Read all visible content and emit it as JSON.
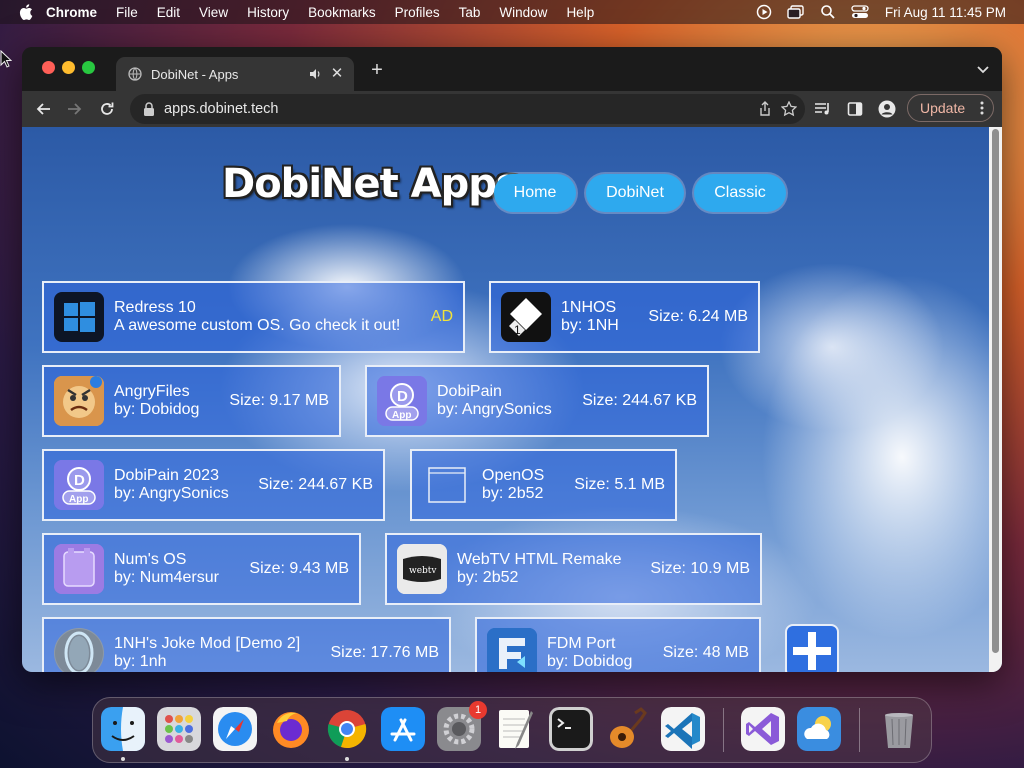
{
  "menubar": {
    "app": "Chrome",
    "items": [
      "File",
      "Edit",
      "View",
      "History",
      "Bookmarks",
      "Profiles",
      "Tab",
      "Window",
      "Help"
    ],
    "clock": "Fri Aug 11  11:45 PM"
  },
  "browser": {
    "tab_title": "DobiNet - Apps",
    "url": "apps.dobinet.tech",
    "update_label": "Update"
  },
  "page": {
    "logo": "DobiNet Apps",
    "nav": [
      "Home",
      "DobiNet",
      "Classic"
    ]
  },
  "apps": [
    {
      "name": "Redress 10",
      "subtitle": "A awesome custom OS. Go check it out!",
      "badge": "AD",
      "icon": "windows-icon"
    },
    {
      "name": "1NHOS",
      "subtitle": "by: 1NH",
      "size": "Size: 6.24 MB",
      "icon": "1nhos-icon"
    },
    {
      "name": "AngryFiles",
      "subtitle": "by: Dobidog",
      "size": "Size: 9.17 MB",
      "icon": "angryfiles-icon"
    },
    {
      "name": "DobiPain",
      "subtitle": "by: AngrySonics",
      "size": "Size: 244.67 KB",
      "icon": "dobipain-icon"
    },
    {
      "name": "DobiPain 2023",
      "subtitle": "by: AngrySonics",
      "size": "Size: 244.67 KB",
      "icon": "dobipain-icon"
    },
    {
      "name": "OpenOS",
      "subtitle": "by: 2b52",
      "size": "Size: 5.1 MB",
      "icon": "window-outline-icon"
    },
    {
      "name": "Num's OS",
      "subtitle": "by: Num4ersur",
      "size": "Size: 9.43 MB",
      "icon": "nums-os-icon"
    },
    {
      "name": "WebTV HTML Remake",
      "subtitle": "by: 2b52",
      "size": "Size: 10.9 MB",
      "icon": "webtv-icon"
    },
    {
      "name": "1NH's Joke Mod [Demo 2]",
      "subtitle": "by: 1nh",
      "size": "Size: 17.76 MB",
      "icon": "joke-mod-icon"
    },
    {
      "name": "FDM Port",
      "subtitle": "by: Dobidog",
      "size": "Size: 48 MB",
      "icon": "fdm-icon"
    }
  ],
  "dock": {
    "settings_badge": "1",
    "apps": [
      "Finder",
      "Launchpad",
      "Safari",
      "Firefox",
      "Chrome",
      "App Store",
      "System Settings",
      "TextEdit",
      "Terminal",
      "GarageBand",
      "Visual Studio Code",
      "Visual Studio",
      "Weather",
      "Trash"
    ]
  },
  "colors": {
    "accent": "#2ea9ee",
    "ad_badge": "#f2e23a",
    "card_border": "#e8eef8"
  }
}
